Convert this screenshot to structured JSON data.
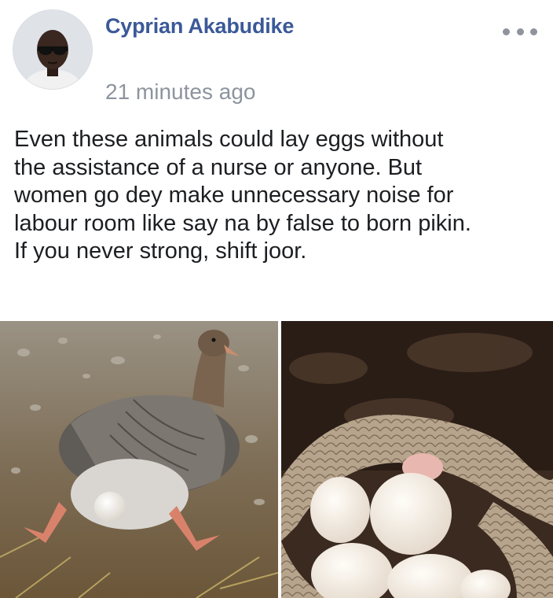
{
  "post": {
    "author": "Cyprian Akabudike",
    "timestamp": "21 minutes ago",
    "text_lines": [
      "Even these animals could lay eggs without",
      "the assistance of a nurse or anyone. But",
      "women go dey make unnecessary noise for",
      "labour room like say na by false to born pikin.",
      "If you never strong, shift joor."
    ],
    "icons": {
      "more": "more-options-icon",
      "avatar": "profile-photo"
    }
  },
  "colors": {
    "author_link": "#3b5998",
    "timestamp": "#8d949e",
    "body_text": "#1c1e21",
    "more_dots": "#90949c"
  }
}
